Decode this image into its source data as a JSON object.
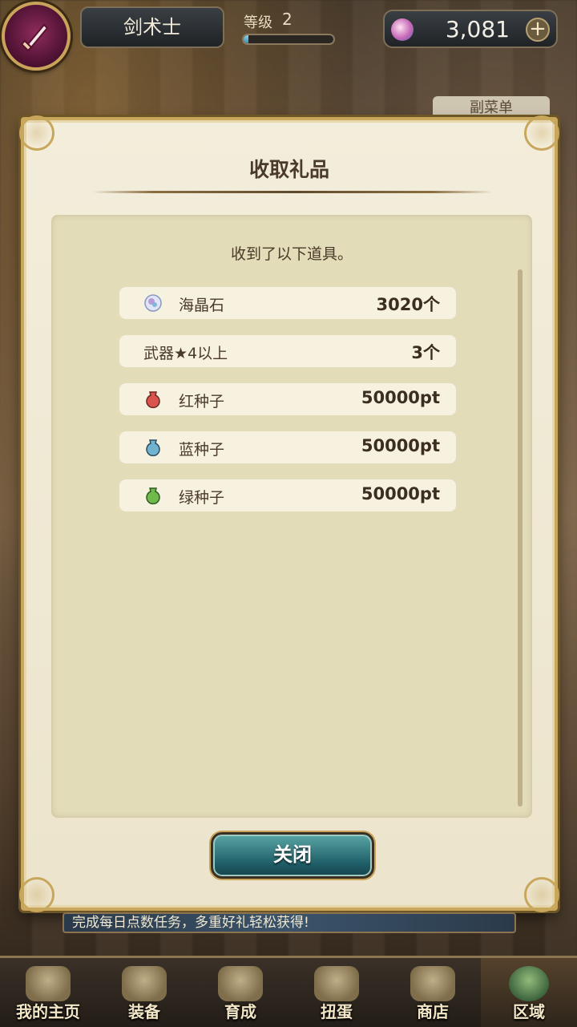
{
  "topbar": {
    "class_name": "剑术士",
    "level_label": "等级",
    "level_value": "2",
    "level_progress": 0.05,
    "gem_amount": "3,081",
    "plus_symbol": "+"
  },
  "background": {
    "side_label": "副菜单"
  },
  "dialog": {
    "title": "收取礼品",
    "message": "收到了以下道具。",
    "items": [
      {
        "name": "海晶石",
        "qty": "3020个",
        "icon": "sea-crystal-icon",
        "color": "#c9d6f0"
      },
      {
        "name": "武器★4以上",
        "qty": "3个",
        "icon": "",
        "color": ""
      },
      {
        "name": "红种子",
        "qty": "50000pt",
        "icon": "red-seed-icon",
        "color": "#d9534f"
      },
      {
        "name": "蓝种子",
        "qty": "50000pt",
        "icon": "blue-seed-icon",
        "color": "#6fb3cf"
      },
      {
        "name": "绿种子",
        "qty": "50000pt",
        "icon": "green-seed-icon",
        "color": "#6fba4a"
      }
    ],
    "close_label": "关闭"
  },
  "ticker": {
    "text": "完成每日点数任务，多重好礼轻松获得!"
  },
  "nav": {
    "tabs": [
      {
        "label": "我的主页",
        "icon": "scroll-icon",
        "active": false
      },
      {
        "label": "装备",
        "icon": "armor-icon",
        "active": false
      },
      {
        "label": "育成",
        "icon": "weapon-icon",
        "active": false
      },
      {
        "label": "扭蛋",
        "icon": "gacha-icon",
        "active": false
      },
      {
        "label": "商店",
        "icon": "shop-icon",
        "active": false
      },
      {
        "label": "区域",
        "icon": "map-icon",
        "active": true
      }
    ]
  }
}
